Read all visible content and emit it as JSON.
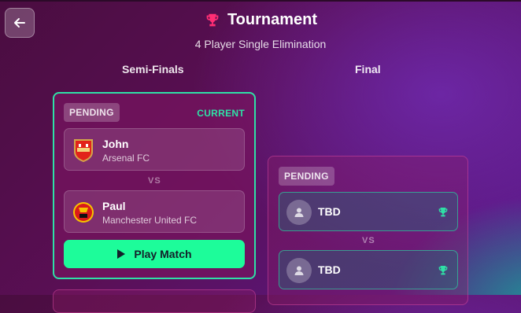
{
  "header": {
    "back_icon": "arrow-left-icon",
    "title": "Tournament",
    "title_icon": "trophy-icon",
    "subtitle": "4 Player Single Elimination"
  },
  "rounds": {
    "semi": "Semi-Finals",
    "final": "Final"
  },
  "semi_match": {
    "status": "PENDING",
    "current_label": "CURRENT",
    "player1": {
      "name": "John",
      "club": "Arsenal FC",
      "crest": "arsenal-crest-icon"
    },
    "vs": "VS",
    "player2": {
      "name": "Paul",
      "club": "Manchester United FC",
      "crest": "manchester-united-crest-icon"
    },
    "play_label": "Play Match"
  },
  "final_match": {
    "status": "PENDING",
    "player1": "TBD",
    "vs": "VS",
    "player2": "TBD"
  },
  "colors": {
    "accent_green": "#2fe0a6",
    "play_button": "#1dfc9a",
    "title_trophy": "#ff2e74"
  }
}
